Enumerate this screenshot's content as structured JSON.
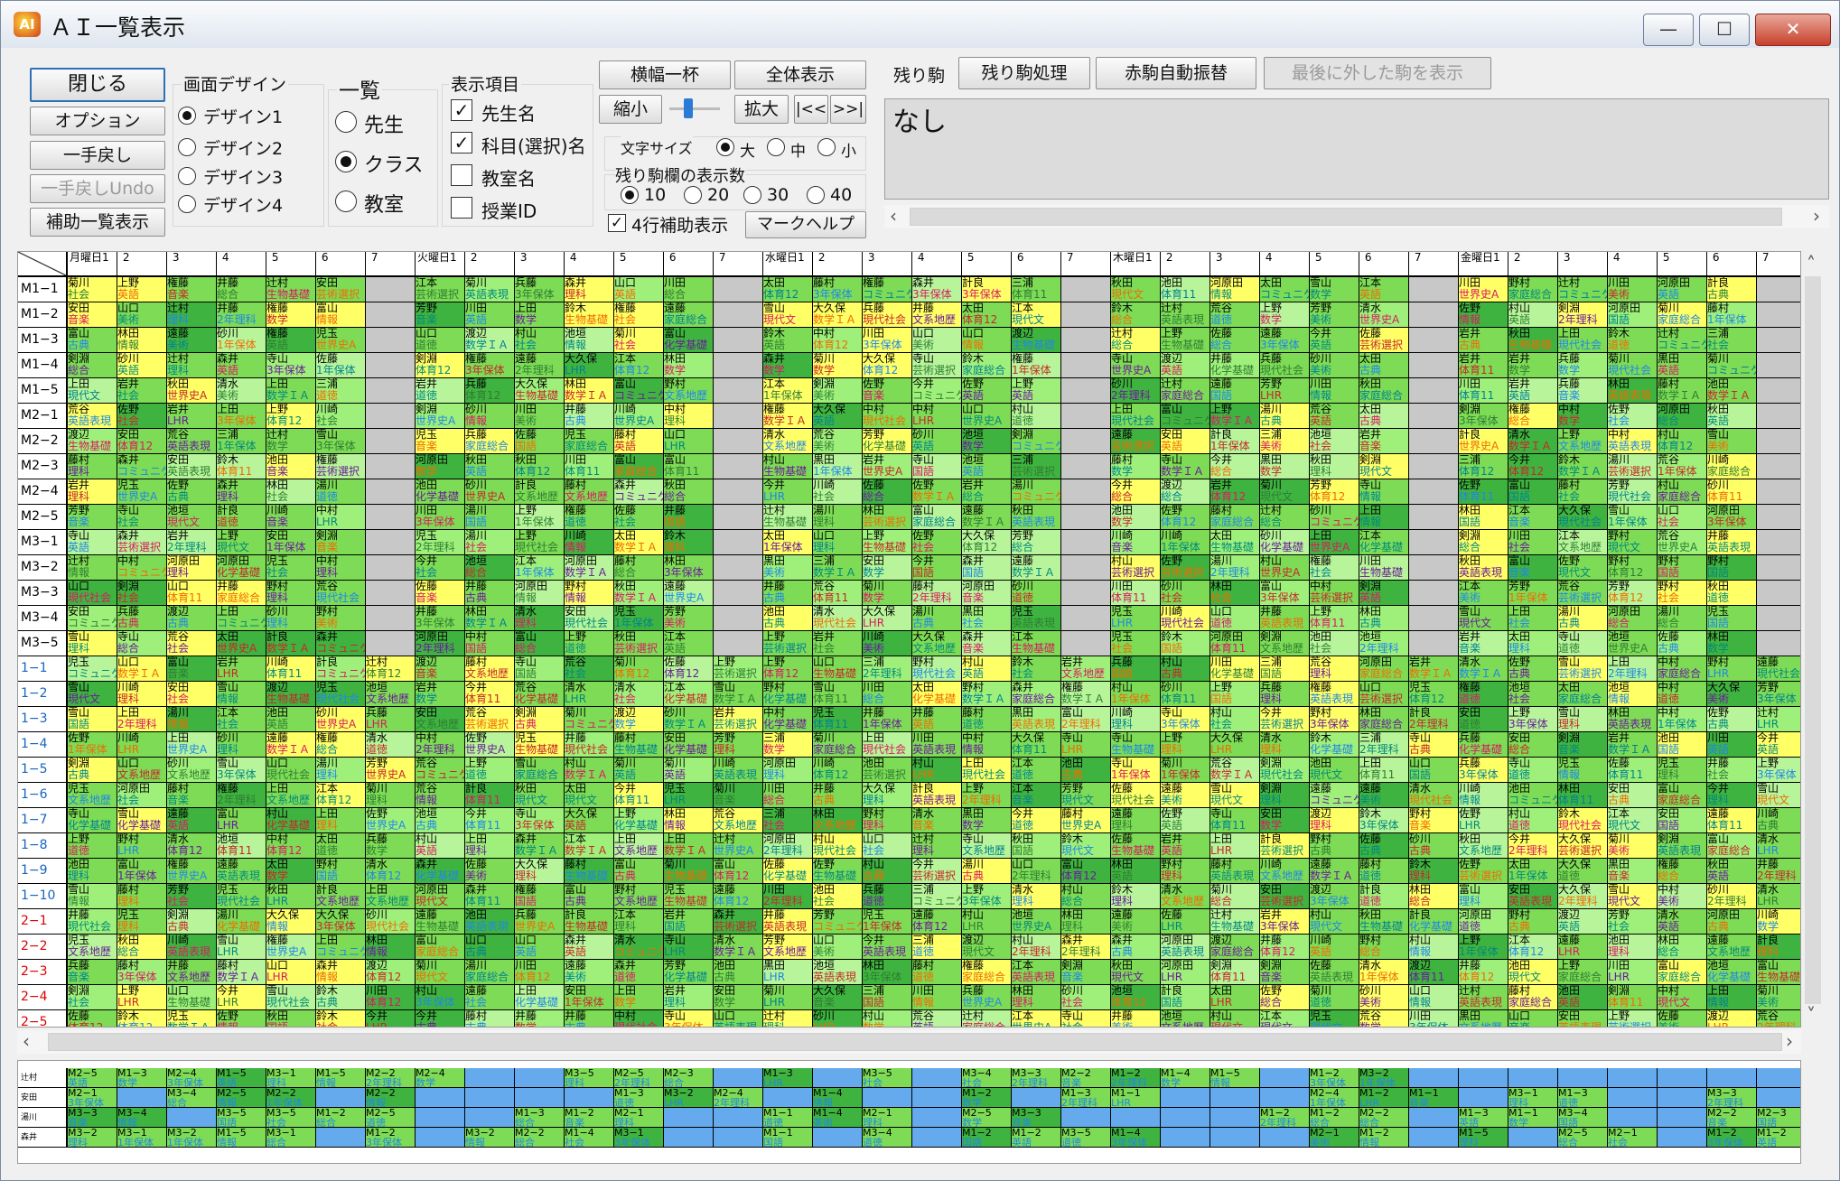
{
  "window": {
    "title": "ＡＩ一覧表示",
    "app_icon_text": "AI",
    "minimize_glyph": "—",
    "maximize_glyph": "☐",
    "close_glyph": "✕"
  },
  "buttons": {
    "close": "閉じる",
    "options": "オプション",
    "undo": "一手戻し",
    "undo_undo": "一手戻しUndo",
    "aux_list": "補助一覧表示",
    "full_width": "横幅一杯",
    "show_all": "全体表示",
    "shrink": "縮小",
    "enlarge": "拡大",
    "first": "|<<",
    "last": ">>|",
    "mark_help": "マークヘルプ",
    "remaining_process": "残り駒処理",
    "red_auto": "赤駒自動振替",
    "show_last_removed": "最後に外した駒を表示"
  },
  "screen_design": {
    "title": "画面デザイン",
    "options": [
      "デザイン1",
      "デザイン2",
      "デザイン3",
      "デザイン4"
    ],
    "selected": 0
  },
  "list_mode": {
    "title": "一覧",
    "options": [
      "先生",
      "クラス",
      "教室"
    ],
    "selected": 1
  },
  "display_items": {
    "title": "表示項目",
    "items": [
      {
        "label": "先生名",
        "checked": true
      },
      {
        "label": "科目(選択)名",
        "checked": true
      },
      {
        "label": "教室名",
        "checked": false
      },
      {
        "label": "授業ID",
        "checked": false
      }
    ]
  },
  "font_size": {
    "title": "文字サイズ",
    "options": [
      "大",
      "中",
      "小"
    ],
    "selected": 0
  },
  "remaining_count": {
    "title": "残り駒欄の表示数",
    "options": [
      "10",
      "20",
      "30",
      "40"
    ],
    "selected": 0
  },
  "four_row_aux": {
    "label": "4行補助表示",
    "checked": true
  },
  "remaining": {
    "label": "残り駒",
    "value": "なし"
  },
  "days": [
    "月曜日",
    "火曜日",
    "水曜日",
    "木曜日",
    "金曜日"
  ],
  "periods": [
    "1",
    "2",
    "3",
    "4",
    "5",
    "6",
    "7"
  ],
  "rows": [
    "M1−1",
    "M1−2",
    "M1−3",
    "M1−4",
    "M1−5",
    "M2−1",
    "M2−2",
    "M2−3",
    "M2−4",
    "M2−5",
    "M3−1",
    "M3−2",
    "M3−3",
    "M3−4",
    "M3−5",
    "1−1",
    "1−2",
    "1−3",
    "1−4",
    "1−5",
    "1−6",
    "1−7",
    "1−8",
    "1−9",
    "1−10",
    "2−1",
    "2−2",
    "2−3",
    "2−4",
    "2−5"
  ],
  "teachers": [
    "岩井",
    "河原田",
    "安田",
    "井藤",
    "今井",
    "川崎",
    "辻村",
    "佐野",
    "湯川",
    "藤村",
    "三浦",
    "剣淵",
    "林田",
    "上田",
    "森井",
    "山口",
    "鈴木",
    "太田",
    "権藤",
    "江本",
    "黒田",
    "遠藤",
    "上野",
    "荒谷",
    "菊川",
    "村山",
    "池垣",
    "渡辺",
    "芳野",
    "佐藤",
    "大久保",
    "児玉",
    "富山",
    "秋田",
    "野村",
    "寺山",
    "計良",
    "池田",
    "川田",
    "清水",
    "中村",
    "砂川",
    "雪山",
    "兵藤"
  ],
  "subjects": [
    "数学",
    "国語",
    "英語",
    "社会",
    "理科",
    "LHR",
    "美術",
    "音楽",
    "道徳",
    "情報",
    "1年保体",
    "2年理科",
    "3年保体",
    "総合",
    "化学基礎",
    "生物基礎",
    "世界史A",
    "現代社会",
    "英語表現",
    "コミュニケ",
    "体育11",
    "体育12",
    "数学ＩＡ",
    "古典",
    "現代文",
    "家庭総合",
    "芸術選択",
    "文系地歴"
  ],
  "aux_rows": [
    "辻村",
    "安田",
    "湯川",
    "森井"
  ]
}
